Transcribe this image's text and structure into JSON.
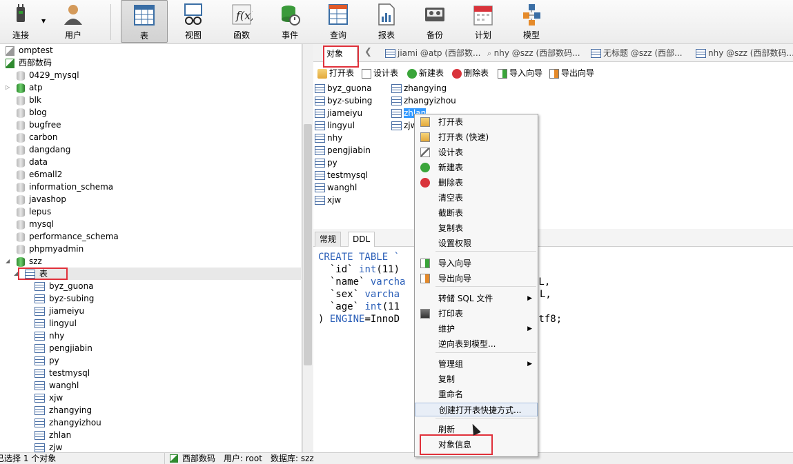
{
  "toolbar": {
    "items": [
      {
        "label": "连接",
        "icon": "connect-plug-icon"
      },
      {
        "label": "用户",
        "icon": "user-icon"
      },
      {
        "label": "表",
        "icon": "table-icon"
      },
      {
        "label": "视图",
        "icon": "view-glasses-icon"
      },
      {
        "label": "函数",
        "icon": "function-fx-icon"
      },
      {
        "label": "事件",
        "icon": "event-clock-icon"
      },
      {
        "label": "查询",
        "icon": "query-grid-icon"
      },
      {
        "label": "报表",
        "icon": "report-icon"
      },
      {
        "label": "备份",
        "icon": "backup-tape-icon"
      },
      {
        "label": "计划",
        "icon": "calendar-icon"
      },
      {
        "label": "模型",
        "icon": "model-diagram-icon"
      }
    ],
    "active": "表"
  },
  "tree": {
    "items": [
      {
        "label": "omptest",
        "kind": "connection-grey"
      },
      {
        "label": "西部数码",
        "kind": "connection-green"
      },
      {
        "label": "0429_mysql",
        "kind": "database"
      },
      {
        "label": "atp",
        "kind": "database-open"
      },
      {
        "label": "blk",
        "kind": "database"
      },
      {
        "label": "blog",
        "kind": "database"
      },
      {
        "label": "bugfree",
        "kind": "database"
      },
      {
        "label": "carbon",
        "kind": "database"
      },
      {
        "label": "dangdang",
        "kind": "database"
      },
      {
        "label": "data",
        "kind": "database"
      },
      {
        "label": "e6mall2",
        "kind": "database"
      },
      {
        "label": "information_schema",
        "kind": "database"
      },
      {
        "label": "javashop",
        "kind": "database"
      },
      {
        "label": "lepus",
        "kind": "database"
      },
      {
        "label": "mysql",
        "kind": "database"
      },
      {
        "label": "performance_schema",
        "kind": "database"
      },
      {
        "label": "phpmyadmin",
        "kind": "database"
      },
      {
        "label": "szz",
        "kind": "database-open"
      },
      {
        "label": "表",
        "kind": "tables-folder"
      },
      {
        "label": "byz_guona",
        "kind": "table"
      },
      {
        "label": "byz-subing",
        "kind": "table"
      },
      {
        "label": "jiameiyu",
        "kind": "table"
      },
      {
        "label": "lingyul",
        "kind": "table"
      },
      {
        "label": "nhy",
        "kind": "table"
      },
      {
        "label": "pengjiabin",
        "kind": "table"
      },
      {
        "label": "py",
        "kind": "table"
      },
      {
        "label": "testmysql",
        "kind": "table"
      },
      {
        "label": "wanghl",
        "kind": "table"
      },
      {
        "label": "xjw",
        "kind": "table"
      },
      {
        "label": "zhangying",
        "kind": "table"
      },
      {
        "label": "zhangyizhou",
        "kind": "table"
      },
      {
        "label": "zhlan",
        "kind": "table"
      },
      {
        "label": "zjw",
        "kind": "table"
      }
    ]
  },
  "tabs": {
    "object_tab": "对象",
    "others": [
      "jiami @atp (西部数...",
      "nhy @szz (西部数码...",
      "无标题 @szz (西部...",
      "nhy @szz (西部数码..."
    ]
  },
  "object_toolbar": {
    "open": "打开表",
    "design": "设计表",
    "new": "新建表",
    "delete": "删除表",
    "import": "导入向导",
    "export": "导出向导"
  },
  "objects": {
    "col1": [
      "byz_guona",
      "byz-subing",
      "jiameiyu",
      "lingyul",
      "nhy",
      "pengjiabin",
      "py",
      "testmysql",
      "wanghl",
      "xjw"
    ],
    "col2": [
      "zhangying",
      "zhangyizhou",
      "zhlan",
      "zjw"
    ],
    "selected": "zhlan"
  },
  "lower_tabs": [
    "常规",
    "DDL"
  ],
  "ddl": {
    "l1a": "CREATE TABLE `",
    "l2a": "  `id` ",
    "l2b": "int",
    "l2c": "(11)",
    "l3a": "  `name` ",
    "l3b": "varcha",
    "l3c": "LL,",
    "l4a": "  `sex` ",
    "l4b": "varcha",
    "l4c": "L,",
    "l5a": "  `age` ",
    "l5b": "int",
    "l5c": "(11",
    "l6a": ") ",
    "l6b": "ENGINE",
    "l6c": "=InnoD",
    "l6d": "utf8;"
  },
  "context_menu": {
    "items": [
      {
        "label": "打开表",
        "icon": "open-table-icon"
      },
      {
        "label": "打开表 (快速)",
        "icon": "open-table-fast-icon"
      },
      {
        "label": "设计表",
        "icon": "design-pencil-icon"
      },
      {
        "label": "新建表",
        "icon": "new-plus-icon"
      },
      {
        "label": "删除表",
        "icon": "delete-minus-icon"
      },
      {
        "label": "清空表"
      },
      {
        "label": "截断表"
      },
      {
        "label": "复制表"
      },
      {
        "label": "设置权限"
      },
      {
        "label": "导入向导",
        "icon": "import-icon"
      },
      {
        "label": "导出向导",
        "icon": "export-icon"
      },
      {
        "label": "转储 SQL 文件",
        "submenu": true
      },
      {
        "label": "打印表",
        "icon": "printer-icon"
      },
      {
        "label": "维护",
        "submenu": true
      },
      {
        "label": "逆向表到模型..."
      },
      {
        "label": "管理组",
        "submenu": true
      },
      {
        "label": "复制"
      },
      {
        "label": "重命名"
      },
      {
        "label": "创建打开表快捷方式..."
      },
      {
        "label": "刷新"
      },
      {
        "label": "对象信息"
      }
    ]
  },
  "status": {
    "left": "已选择 1 个对象",
    "connection": "西部数码",
    "user": "用户: root",
    "database": "数据库: szz"
  },
  "colors": {
    "highlight": "#e0303a",
    "selection": "#3399ff",
    "keyword": "#2b5fb8"
  }
}
